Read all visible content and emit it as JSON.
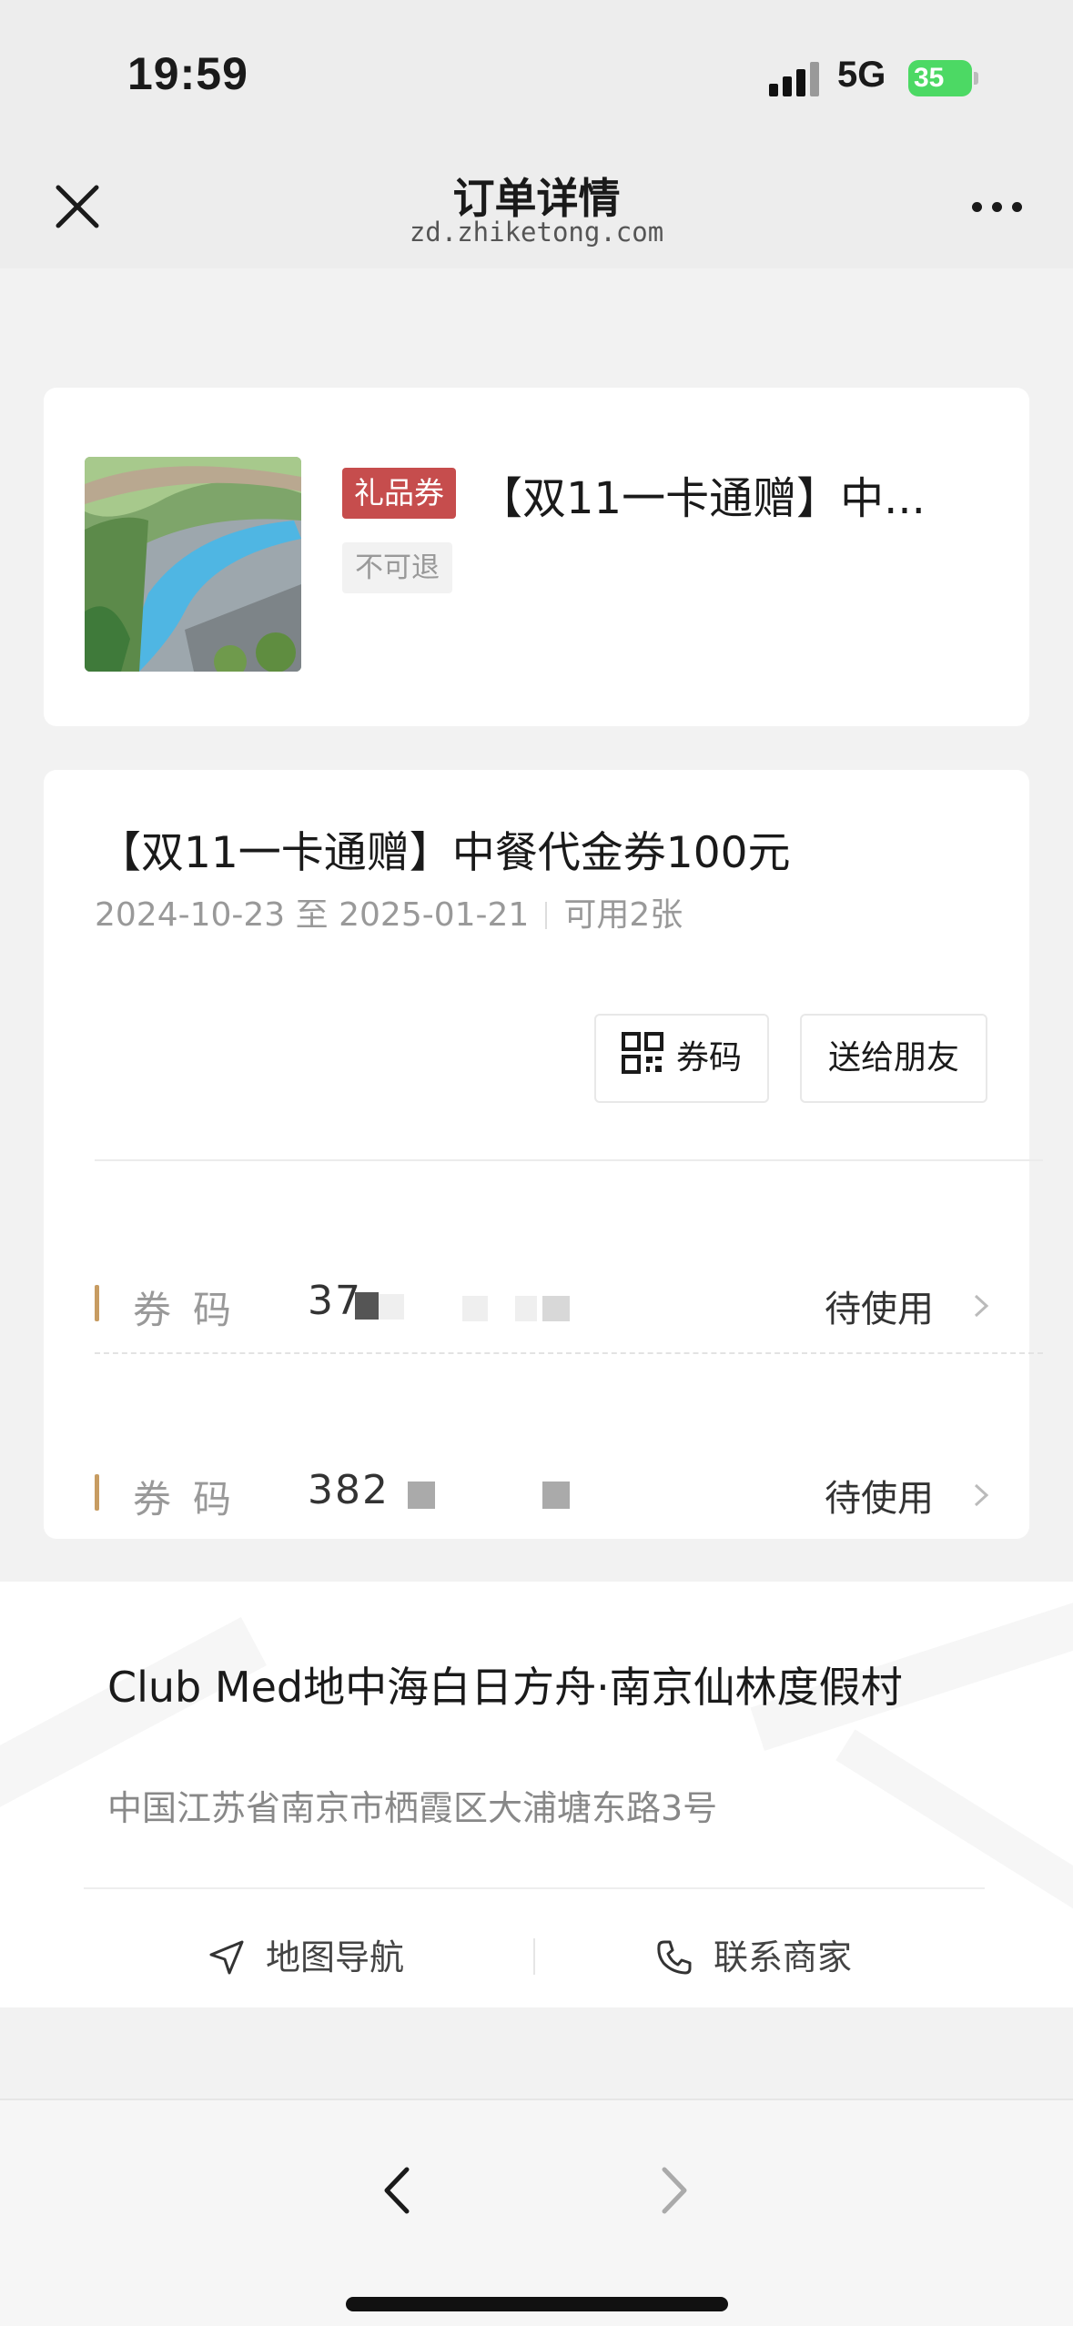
{
  "status_bar": {
    "time": "19:59",
    "network": "5G",
    "battery": "35"
  },
  "nav": {
    "title": "订单详情",
    "url": "zd.zhiketong.com"
  },
  "product": {
    "tag": "礼品券",
    "name": "【双11一卡通赠】中...",
    "refund_tag": "不可退"
  },
  "voucher": {
    "title": "【双11一卡通赠】中餐代金券100元",
    "validity": "2024-10-23 至 2025-01-21",
    "available": "可用2张",
    "code_button": "券码",
    "gift_button": "送给朋友",
    "codes": [
      {
        "label": "券码",
        "value": "37",
        "status": "待使用"
      },
      {
        "label": "券码",
        "value": "382",
        "status": "待使用"
      }
    ]
  },
  "merchant": {
    "name": "Club Med地中海白日方舟·南京仙林度假村",
    "address": "中国江苏省南京市栖霞区大浦塘东路3号",
    "navigate_label": "地图导航",
    "contact_label": "联系商家"
  },
  "colors": {
    "gift_tag": "#c64d4d",
    "code_mark": "#c79c62",
    "battery": "#4cd964"
  }
}
